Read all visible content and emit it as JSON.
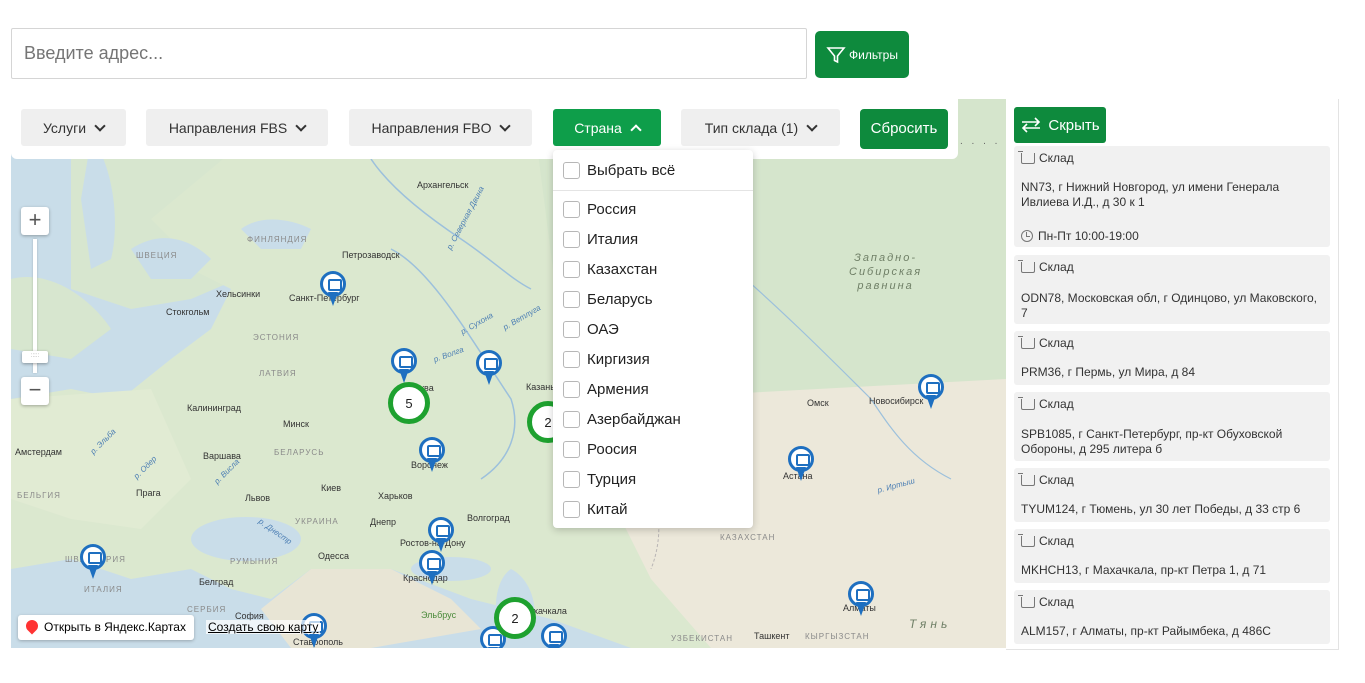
{
  "search": {
    "placeholder": "Введите адрес..."
  },
  "filters_button": {
    "label": "Фильтры",
    "icon": "funnel-icon"
  },
  "filter_bar": {
    "buttons": [
      {
        "label": "Услуги",
        "active": false
      },
      {
        "label": "Направления FBS",
        "active": false
      },
      {
        "label": "Направления FBO",
        "active": false
      },
      {
        "label": "Страна",
        "active": true
      },
      {
        "label": "Тип склада (1)",
        "active": false
      }
    ],
    "reset_label": "Сбросить"
  },
  "country_dropdown": {
    "select_all": "Выбрать всё",
    "options": [
      "Россия",
      "Италия",
      "Казахстан",
      "Беларусь",
      "ОАЭ",
      "Киргизия",
      "Армения",
      "Азербайджан",
      "Роосия",
      "Турция",
      "Китай"
    ]
  },
  "hide_button": {
    "label": "Скрыть",
    "icon": "swap-arrows-icon"
  },
  "map": {
    "labels": {
      "arkhangelsk": "Архангельск",
      "finland": "ФИНЛЯНДИЯ",
      "sweden": "ШВЕЦИЯ",
      "petrozavodsk": "Петрозаводск",
      "helsinki": "Хельсинки",
      "spb": "Санкт-Петербург",
      "stockholm": "Стокгольм",
      "estonia": "ЭСТОНИЯ",
      "latvia": "ЛАТВИЯ",
      "moscow": "Москва",
      "kazan": "Казань",
      "kaliningrad": "Калининград",
      "minsk": "Минск",
      "warsaw": "Варшава",
      "belarus": "БЕЛАРУСЬ",
      "amsterdam": "Амстердам",
      "voronezh": "Воронеж",
      "kyiv": "Киев",
      "kharkiv": "Харьков",
      "prague": "Прага",
      "lviv": "Львов",
      "belgium": "БЕЛЬГИЯ",
      "ukraine": "УКРАИНА",
      "dnepr": "Днепр",
      "volgograd": "Волгоград",
      "rostov": "Ростов-на-Дону",
      "odessa": "Одесса",
      "krasnodar": "Краснодар",
      "switzerland": "ШВЕЙЦАРИЯ",
      "romania": "РУМЫНИЯ",
      "belgrade": "Белград",
      "italy": "ИТАЛИЯ",
      "serbia": "СЕРБИЯ",
      "sofia": "София",
      "stavropol": "Ставрополь",
      "elbrus": "Эльбрус",
      "makhachkala": "Махачкала",
      "omsk": "Омск",
      "novosibirsk": "Новосибирск",
      "astana": "Астана",
      "kazakhstan": "КАЗАХСТАН",
      "uzbekistan": "УЗБЕКИСТАН",
      "tashkent": "Ташкент",
      "kyrgyzstan": "КЫРГЫЗСТАН",
      "almaty": "Алматы",
      "west_siberian": "Западно-\nСибирская\nравнина",
      "severnaya_dvina": "р. Северная Двина",
      "sukhona": "р. Сухона",
      "vetluga": "р. Ветлуга",
      "volga": "р. Волга",
      "irtysh": "р. Иртыш",
      "oder": "р. Одер",
      "elba": "р. Эльба",
      "dniester": "р. Днестр",
      "vistula": "р. Висла",
      "tyan": "Тянь"
    },
    "clusters": [
      {
        "count": "5"
      },
      {
        "count": "2"
      },
      {
        "count": "2"
      }
    ],
    "zoom_in": "+",
    "zoom_out": "−",
    "zoom_handle": ":::::",
    "yandex_link": "Открыть в Яндекс.Картах",
    "create_map_link": "Создать свою карту"
  },
  "warehouses": [
    {
      "type": "Склад",
      "address": "NN73, г Нижний Новгород, ул имени Генерала Ивлиева И.Д., д 30 к 1",
      "hours": "Пн-Пт 10:00-19:00"
    },
    {
      "type": "Склад",
      "address": "ODN78, Московская обл, г Одинцово, ул Маковского, 7"
    },
    {
      "type": "Склад",
      "address": "PRM36, г Пермь, ул Мира, д 84"
    },
    {
      "type": "Склад",
      "address": "SPB1085, г Санкт-Петербург, пр-кт Обуховской Обороны, д 295 литера б"
    },
    {
      "type": "Склад",
      "address": "TYUM124, г Тюмень, ул 30 лет Победы, д 33 стр 6"
    },
    {
      "type": "Склад",
      "address": "MKHCH13, г Махачкала, пр-кт Петра 1, д 71"
    },
    {
      "type": "Склад",
      "address": "ALM157, г Алматы, пр-кт Райымбека, д 486С"
    }
  ],
  "colors": {
    "accent": "#0e8a3d",
    "cluster": "#1ea12f",
    "pin": "#1e6fc0"
  }
}
